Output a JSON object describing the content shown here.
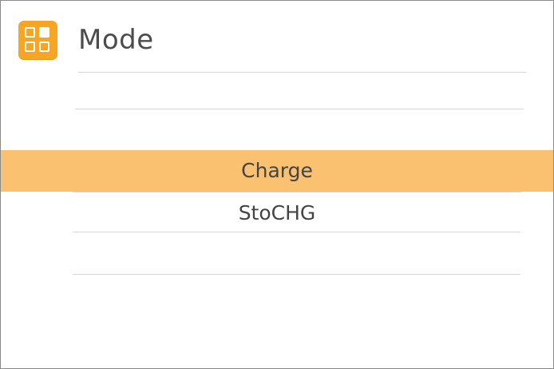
{
  "header": {
    "title": "Mode",
    "icon": "grid-apps-icon",
    "icon_color": "#f6a623"
  },
  "options": {
    "items": [
      {
        "label": ""
      },
      {
        "label": "Charge",
        "selected": true
      },
      {
        "label": "StoCHG"
      },
      {
        "label": ""
      }
    ],
    "selected_color": "#fac171"
  }
}
